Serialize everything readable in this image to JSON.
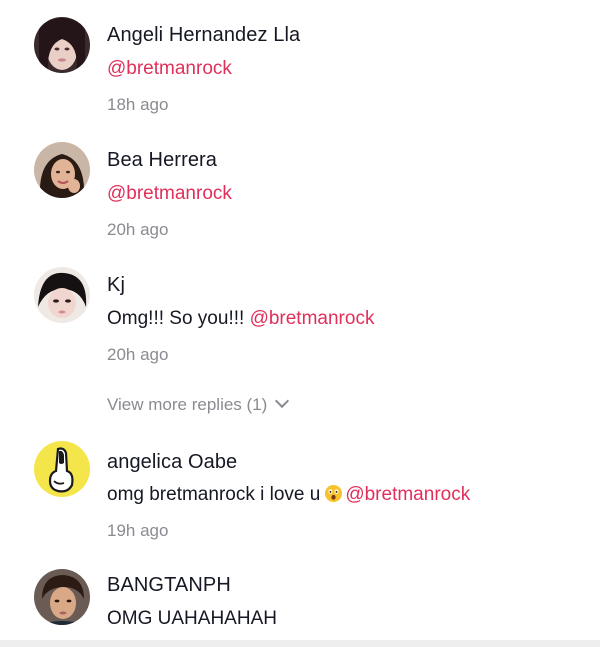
{
  "comments": [
    {
      "username": "Angeli Hernandez Lla",
      "text_prefix": "",
      "mention": "@bretmanrock",
      "time": "18h ago"
    },
    {
      "username": "Bea Herrera",
      "text_prefix": "",
      "mention": "@bretmanrock",
      "time": "20h ago"
    },
    {
      "username": "Kj",
      "text_prefix": "Omg!!! So you!!! ",
      "mention": "@bretmanrock",
      "time": "20h ago"
    },
    {
      "username": "angelica Oabe",
      "text_prefix": "omg bretmanrock i love u",
      "emoji": "astonished-face-emoji",
      "mention": "@bretmanrock",
      "time": "19h ago"
    },
    {
      "username": "BANGTANPH",
      "text_prefix": "OMG UAHAHAHAH",
      "mention": ""
    }
  ],
  "view_more": {
    "label": "View more replies (1)",
    "icon": "chevron-down-icon"
  },
  "colors": {
    "mention": "#e0305a",
    "username": "#161823",
    "meta": "#8a8b91"
  }
}
